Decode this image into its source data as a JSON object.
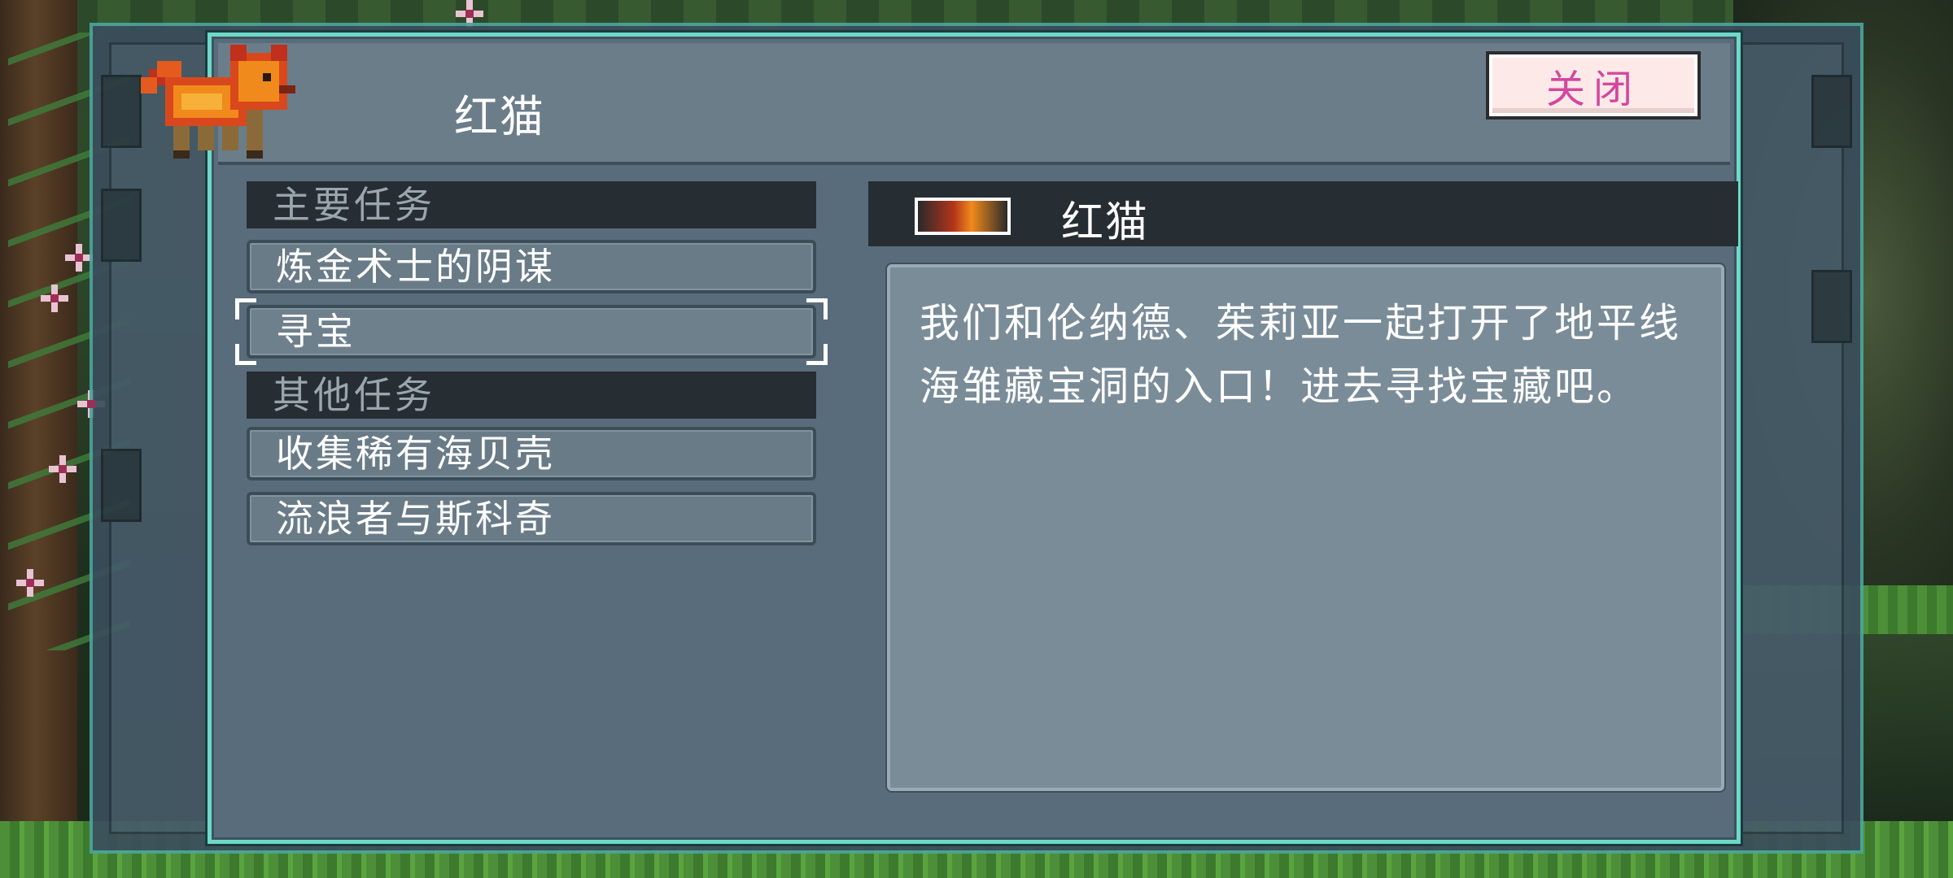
{
  "dialog": {
    "title": "红猫",
    "close_label": "关闭"
  },
  "quest_list": {
    "main_header": "主要任务",
    "main_quests": [
      {
        "label": "炼金术士的阴谋"
      },
      {
        "label": "寻宝",
        "selected": true
      }
    ],
    "other_header": "其他任务",
    "other_quests": [
      {
        "label": "收集稀有海贝壳"
      },
      {
        "label": "流浪者与斯科奇"
      }
    ]
  },
  "detail": {
    "title": "红猫",
    "text": "我们和伦纳德、茱莉亚一起打开了地平线海雏藏宝洞的入口！进去寻找宝藏吧。"
  },
  "colors": {
    "dialog_border": "#6ed8c9",
    "dialog_bg": "#596c7b",
    "close_button_text": "#d3479f",
    "close_button_bg": "#fde9e7",
    "section_header_bg": "#272e33"
  },
  "icons": {
    "dialog_portrait": "red-cat-sprite-icon",
    "detail_portrait": "red-cat-mini-sprite-icon"
  }
}
